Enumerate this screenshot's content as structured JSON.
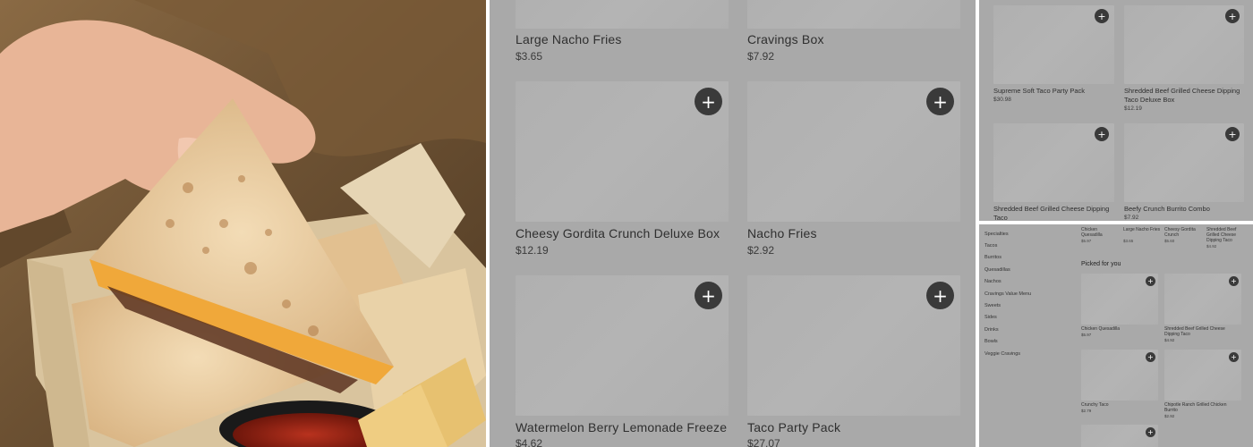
{
  "panel_photo": {
    "description_icon": "quesadilla-photo"
  },
  "panel_main": {
    "items": [
      {
        "name": "Large Nacho Fries",
        "price": "$3.65"
      },
      {
        "name": "Cravings Box",
        "price": "$7.92"
      },
      {
        "name": "Cheesy Gordita Crunch Deluxe Box",
        "price": "$12.19"
      },
      {
        "name": "Nacho Fries",
        "price": "$2.92"
      },
      {
        "name": "Watermelon Berry Lemonade Freeze",
        "price": "$4.62"
      },
      {
        "name": "Taco Party Pack",
        "price": "$27.07"
      }
    ],
    "add_label": "+"
  },
  "panel_party": {
    "items": [
      {
        "name": "Supreme Soft Taco Party Pack",
        "price": "$30.98"
      },
      {
        "name": "Shredded Beef Grilled Cheese Dipping Taco Deluxe Box",
        "price": "$12.19"
      },
      {
        "name": "Shredded Beef Grilled Cheese Dipping Taco",
        "price": ""
      },
      {
        "name": "Beefy Crunch Burrito Combo",
        "price": "$7.92"
      }
    ],
    "add_label": "+"
  },
  "panel_menu": {
    "sidebar": [
      "Specialties",
      "Tacos",
      "Burritos",
      "Quesadillas",
      "Nachos",
      "Cravings Value Menu",
      "Sweets",
      "Sides",
      "Drinks",
      "Bowls",
      "Veggie Cravings"
    ],
    "top_row": [
      {
        "name": "Chicken Quesadilla",
        "price": "$5.97"
      },
      {
        "name": "Large Nacho Fries",
        "price": "$3.65"
      },
      {
        "name": "Cheesy Gordita Crunch",
        "price": "$5.60"
      },
      {
        "name": "Shredded Beef Grilled Cheese Dipping Taco",
        "price": "$4.92"
      }
    ],
    "section_title": "Picked for you",
    "items": [
      {
        "name": "Chicken Quesadilla",
        "price": "$5.97"
      },
      {
        "name": "Shredded Beef Grilled Cheese Dipping Taco",
        "price": "$4.92"
      },
      {
        "name": "Crunchy Taco",
        "price": "$2.79"
      },
      {
        "name": "Chipotle Ranch Grilled Chicken Burrito",
        "price": "$2.92"
      }
    ],
    "add_label": "+"
  }
}
